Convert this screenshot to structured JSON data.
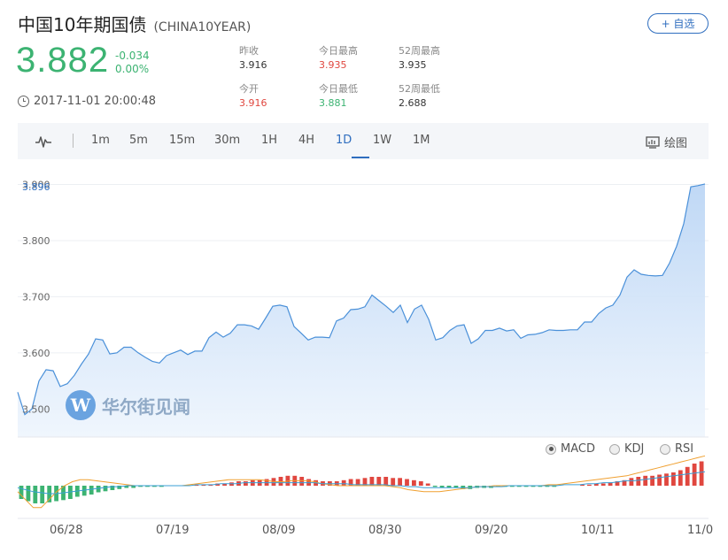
{
  "header": {
    "title": "中国10年期国债",
    "code": "(CHINA10YEAR)",
    "add_button": "+ 自选"
  },
  "quote": {
    "price": "3.882",
    "change": "-0.034",
    "change_pct": "0.00%",
    "timestamp": "2017-11-01 20:00:48"
  },
  "stats": {
    "prev_close_label": "昨收",
    "prev_close": "3.916",
    "today_high_label": "今日最高",
    "today_high": "3.935",
    "wk52_high_label": "52周最高",
    "wk52_high": "3.935",
    "open_label": "今开",
    "open": "3.916",
    "today_low_label": "今日最低",
    "today_low": "3.881",
    "wk52_low_label": "52周最低",
    "wk52_low": "2.688"
  },
  "toolbar": {
    "periods": [
      "1m",
      "5m",
      "15m",
      "30m",
      "1H",
      "4H",
      "1D",
      "1W",
      "1M"
    ],
    "active": "1D",
    "draw_label": "绘图",
    "icons": [
      "chart-type-icon",
      "draw-icon"
    ]
  },
  "indicators": {
    "tabs": [
      "MACD",
      "KDJ",
      "RSI"
    ],
    "selected": "MACD"
  },
  "watermark": {
    "logo_letter": "W",
    "text": "华尔街见闻"
  },
  "colors": {
    "up": "#e0473f",
    "down": "#3cb372",
    "accent": "#2f6ebf",
    "line": "#4a90d9"
  },
  "chart_data": {
    "type": "area",
    "y_tick_labels": [
      "3.500",
      "3.600",
      "3.700",
      "3.800",
      "3.896",
      "3.900"
    ],
    "y_ticks": [
      3.5,
      3.6,
      3.7,
      3.8,
      3.9
    ],
    "ylim": [
      3.45,
      3.945
    ],
    "last_value_label": "3.896",
    "x_tick_labels": [
      "06/28",
      "07/19",
      "08/09",
      "08/30",
      "09/20",
      "10/11",
      "11/0"
    ],
    "series": [
      {
        "values": [
          3.53,
          3.49,
          3.5,
          3.55,
          3.57,
          3.568,
          3.54,
          3.545,
          3.56,
          3.58,
          3.598,
          3.625,
          3.623,
          3.598,
          3.6,
          3.61,
          3.61,
          3.6,
          3.592,
          3.585,
          3.582,
          3.595,
          3.6,
          3.605,
          3.597,
          3.603,
          3.603,
          3.627,
          3.637,
          3.628,
          3.635,
          3.65,
          3.65,
          3.648,
          3.642,
          3.662,
          3.683,
          3.685,
          3.682,
          3.647,
          3.635,
          3.623,
          3.628,
          3.628,
          3.627,
          3.657,
          3.662,
          3.677,
          3.678,
          3.682,
          3.703,
          3.693,
          3.683,
          3.672,
          3.685,
          3.654,
          3.678,
          3.685,
          3.66,
          3.623,
          3.627,
          3.64,
          3.648,
          3.65,
          3.617,
          3.625,
          3.64,
          3.64,
          3.644,
          3.639,
          3.641,
          3.626,
          3.632,
          3.633,
          3.636,
          3.641,
          3.64,
          3.64,
          3.641,
          3.641,
          3.655,
          3.655,
          3.67,
          3.68,
          3.685,
          3.703,
          3.735,
          3.748,
          3.74,
          3.738,
          3.737,
          3.738,
          3.76,
          3.79,
          3.83,
          3.896,
          3.898,
          3.901
        ]
      }
    ],
    "macd_hist": [
      -0.012,
      -0.014,
      -0.016,
      -0.016,
      -0.015,
      -0.014,
      -0.013,
      -0.012,
      -0.01,
      -0.009,
      -0.008,
      -0.006,
      -0.005,
      -0.004,
      -0.003,
      -0.002,
      -0.002,
      -0.001,
      -0.001,
      -0.001,
      -0.001,
      0.0,
      0.0,
      0.0,
      0.0,
      0.001,
      0.001,
      0.001,
      0.002,
      0.002,
      0.003,
      0.004,
      0.004,
      0.005,
      0.005,
      0.006,
      0.007,
      0.008,
      0.009,
      0.009,
      0.008,
      0.006,
      0.005,
      0.004,
      0.004,
      0.004,
      0.005,
      0.006,
      0.006,
      0.007,
      0.008,
      0.008,
      0.008,
      0.007,
      0.007,
      0.006,
      0.005,
      0.004,
      0.002,
      -0.001,
      -0.002,
      -0.002,
      -0.002,
      -0.003,
      -0.003,
      -0.002,
      -0.002,
      -0.002,
      -0.001,
      -0.001,
      -0.001,
      -0.001,
      -0.001,
      -0.001,
      -0.001,
      -0.001,
      -0.001,
      0.0,
      0.0,
      0.0,
      0.001,
      0.001,
      0.002,
      0.002,
      0.003,
      0.004,
      0.005,
      0.007,
      0.008,
      0.009,
      0.009,
      0.01,
      0.011,
      0.012,
      0.014,
      0.017,
      0.02,
      0.022
    ],
    "dif": [
      -0.006,
      -0.014,
      -0.022,
      -0.022,
      -0.014,
      -0.006,
      0.0,
      0.004,
      0.006,
      0.006,
      0.005,
      0.004,
      0.003,
      0.002,
      0.001,
      0.0,
      0.0,
      0.0,
      0.0,
      0.0,
      0.0,
      0.0,
      0.001,
      0.002,
      0.003,
      0.004,
      0.005,
      0.006,
      0.006,
      0.006,
      0.006,
      0.006,
      0.005,
      0.004,
      0.004,
      0.005,
      0.005,
      0.005,
      0.004,
      0.002,
      0.001,
      0.0,
      0.0,
      0.0,
      0.0,
      0.0,
      0.0,
      0.0,
      -0.001,
      -0.002,
      -0.004,
      -0.005,
      -0.006,
      -0.006,
      -0.006,
      -0.005,
      -0.004,
      -0.003,
      -0.002,
      -0.001,
      -0.001,
      0.0,
      0.0,
      0.0,
      0.0,
      0.0,
      0.0,
      0.0,
      0.001,
      0.001,
      0.002,
      0.003,
      0.004,
      0.005,
      0.006,
      0.007,
      0.008,
      0.009,
      0.01,
      0.012,
      0.014,
      0.016,
      0.018,
      0.02,
      0.022,
      0.024,
      0.026,
      0.028,
      0.03
    ],
    "dea": [
      -0.002,
      -0.004,
      -0.006,
      -0.007,
      -0.008,
      -0.008,
      -0.007,
      -0.006,
      -0.005,
      -0.004,
      -0.003,
      -0.002,
      -0.001,
      -0.001,
      0.0,
      0.0,
      0.0,
      0.0,
      0.0,
      0.0,
      0.0,
      0.0,
      0.0,
      0.001,
      0.001,
      0.001,
      0.002,
      0.002,
      0.002,
      0.003,
      0.003,
      0.003,
      0.003,
      0.003,
      0.003,
      0.003,
      0.003,
      0.003,
      0.003,
      0.002,
      0.002,
      0.002,
      0.002,
      0.001,
      0.001,
      0.001,
      0.001,
      0.001,
      0.0,
      0.0,
      -0.001,
      -0.001,
      -0.002,
      -0.002,
      -0.002,
      -0.002,
      -0.002,
      -0.002,
      -0.002,
      -0.001,
      -0.001,
      -0.001,
      -0.001,
      0.0,
      0.0,
      0.0,
      0.0,
      0.0,
      0.0,
      0.0,
      0.001,
      0.001,
      0.001,
      0.002,
      0.002,
      0.003,
      0.003,
      0.004,
      0.005,
      0.005,
      0.006,
      0.007,
      0.008,
      0.009,
      0.01,
      0.011,
      0.012,
      0.013,
      0.014
    ]
  }
}
